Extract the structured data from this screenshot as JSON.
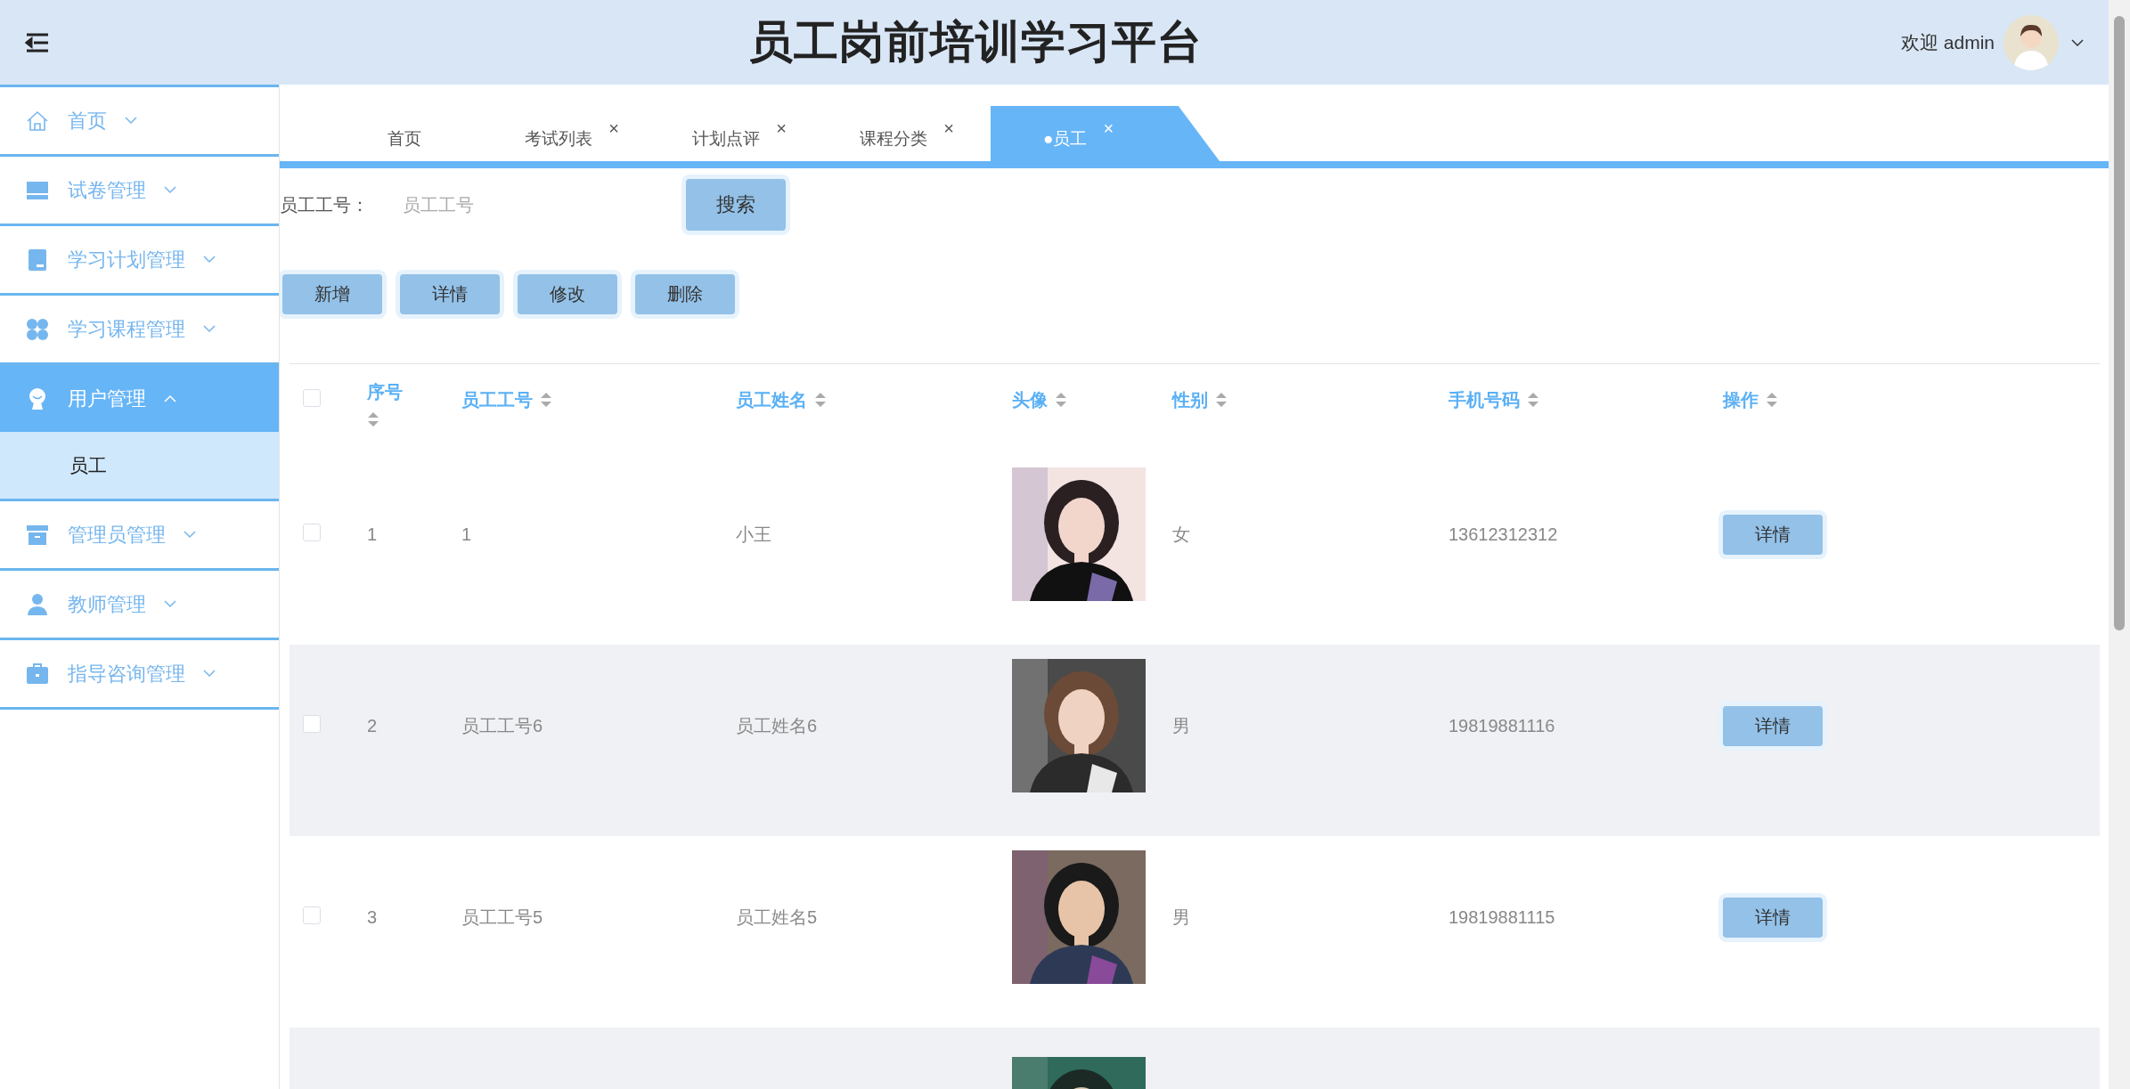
{
  "header": {
    "title": "员工岗前培训学习平台",
    "welcome": "欢迎 admin"
  },
  "sidebar": {
    "items": [
      {
        "label": "首页",
        "expanded": false,
        "selected": false
      },
      {
        "label": "试卷管理",
        "expanded": false,
        "selected": false
      },
      {
        "label": "学习计划管理",
        "expanded": false,
        "selected": false
      },
      {
        "label": "学习课程管理",
        "expanded": false,
        "selected": false
      },
      {
        "label": "用户管理",
        "expanded": true,
        "selected": true,
        "children": [
          {
            "label": "员工",
            "selected": true
          }
        ]
      },
      {
        "label": "管理员管理",
        "expanded": false,
        "selected": false
      },
      {
        "label": "教师管理",
        "expanded": false,
        "selected": false
      },
      {
        "label": "指导咨询管理",
        "expanded": false,
        "selected": false
      }
    ]
  },
  "tabs": [
    {
      "label": "首页",
      "selected": false
    },
    {
      "label": "考试列表",
      "close": "×",
      "selected": false
    },
    {
      "label": "计划点评",
      "close": "×",
      "selected": false
    },
    {
      "label": "课程分类",
      "close": "×",
      "selected": false
    },
    {
      "label": "●员工",
      "close": "×",
      "selected": true
    }
  ],
  "search": {
    "label": "员工工号：",
    "placeholder": "员工工号",
    "button": "搜索"
  },
  "actions": [
    "新增",
    "详情",
    "修改",
    "删除"
  ],
  "table": {
    "select_all": {
      "checked": false
    },
    "columns": [
      "序号",
      "员工工号",
      "员工姓名",
      "头像",
      "性别",
      "手机号码",
      "操作"
    ],
    "rows": [
      {
        "checked": false,
        "index": "1",
        "employee_no": "1",
        "name": "小王",
        "avatar": {
          "kind": "picture"
        },
        "gender": "女",
        "phone": "13612312312",
        "action": "详情"
      },
      {
        "checked": false,
        "index": "2",
        "employee_no": "员工工号6",
        "name": "员工姓名6",
        "avatar": {
          "kind": "picture"
        },
        "gender": "男",
        "phone": "19819881116",
        "action": "详情"
      },
      {
        "checked": false,
        "index": "3",
        "employee_no": "员工工号5",
        "name": "员工姓名5",
        "avatar": {
          "kind": "picture"
        },
        "gender": "男",
        "phone": "19819881115",
        "action": "详情"
      }
    ],
    "partial_row": {
      "avatar": {
        "kind": "picture"
      }
    }
  }
}
